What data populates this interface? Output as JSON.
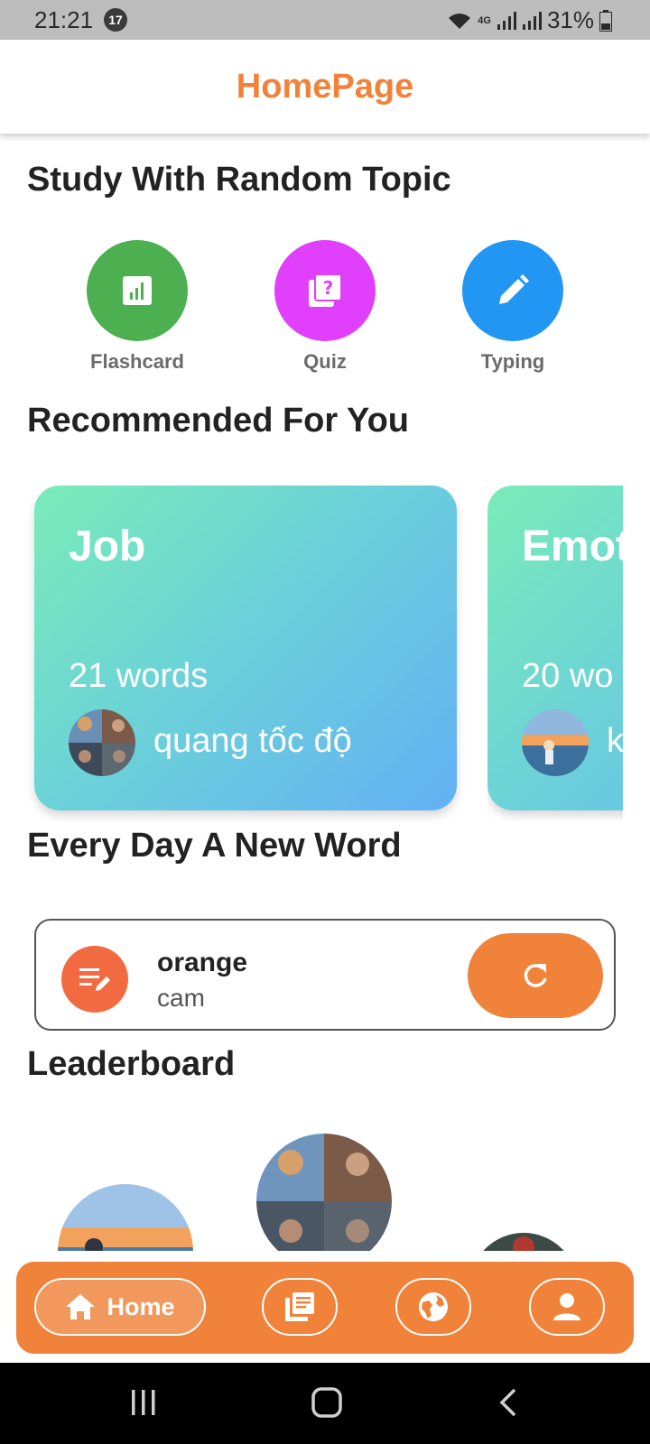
{
  "status_bar": {
    "time": "21:21",
    "notification_count": "17",
    "network": "4G",
    "battery": "31%"
  },
  "app_bar": {
    "title": "HomePage"
  },
  "random_topic": {
    "title": "Study With Random Topic",
    "modes": [
      {
        "label": "Flashcard",
        "color": "#4caf50",
        "icon": "bar-chart-icon"
      },
      {
        "label": "Quiz",
        "color": "#e040fb",
        "icon": "quiz-icon"
      },
      {
        "label": "Typing",
        "color": "#2196f3",
        "icon": "pencil-icon"
      }
    ]
  },
  "recommended": {
    "title": "Recommended For You",
    "cards": [
      {
        "title": "Job",
        "count": "21 words",
        "author": "quang tốc độ"
      },
      {
        "title": "Emot",
        "count": "20 wo",
        "author": "k"
      }
    ]
  },
  "word_of_day": {
    "title": "Every Day A New Word",
    "word": "orange",
    "meaning": "cam"
  },
  "leaderboard": {
    "title": "Leaderboard"
  },
  "bottom_nav": {
    "home_label": "Home",
    "accent": "#f0823a"
  }
}
